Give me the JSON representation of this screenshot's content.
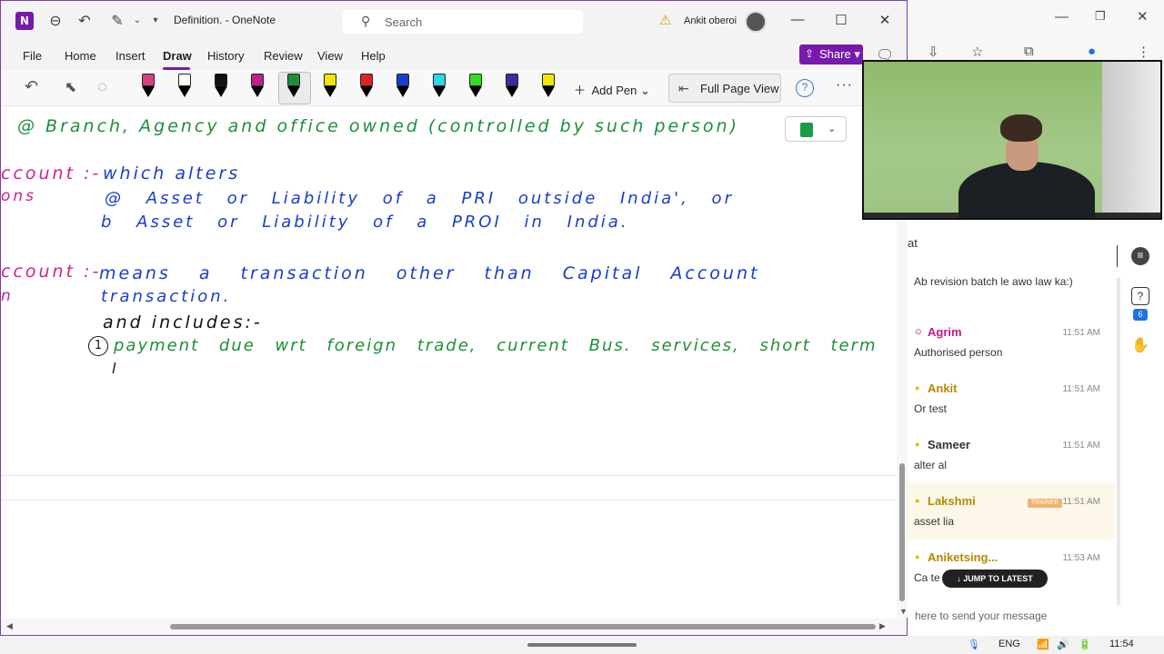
{
  "window": {
    "app_logo": "N",
    "title": "Definition.  -  OneNote",
    "search_placeholder": "Search",
    "user_name": "Ankit oberoi"
  },
  "menu": {
    "file": "File",
    "home": "Home",
    "insert": "Insert",
    "draw": "Draw",
    "history": "History",
    "review": "Review",
    "view": "View",
    "help": "Help",
    "share": "Share"
  },
  "ribbon": {
    "add_pen": "Add Pen",
    "full_page_view": "Full Page View",
    "pens": [
      {
        "color": "#d8407f",
        "name": "eraser"
      },
      {
        "color": "#ffffff",
        "name": "pen-white"
      },
      {
        "color": "#111111",
        "name": "pen-black"
      },
      {
        "color": "#c0208a",
        "name": "pen-magenta"
      },
      {
        "color": "#1d8f3a",
        "name": "pen-green-selected"
      },
      {
        "color": "#f2e500",
        "name": "highlighter-yellow"
      },
      {
        "color": "#e0202a",
        "name": "pen-red"
      },
      {
        "color": "#1a3ccc",
        "name": "pen-blue"
      },
      {
        "color": "#2ad8e8",
        "name": "highlighter-cyan"
      },
      {
        "color": "#33dd22",
        "name": "highlighter-green"
      },
      {
        "color": "#3a2f9a",
        "name": "pen-indigo"
      },
      {
        "color": "#f5e600",
        "name": "pen-yellow"
      }
    ]
  },
  "notes": {
    "line_branch": "@ Branch, Agency and office owned (controlled by such person)",
    "cap_account_1": "ccount :-",
    "cap_account_2": "ons",
    "which_alters": "which alters",
    "item_a": "@ Asset or Liability of a PRI outside India', or",
    "item_b": "b Asset or Liability of a PROI in India.",
    "cur_account_1": "ccount :-",
    "cur_account_2": "n",
    "means": "means a transaction other than Capital Account",
    "transaction": "transaction.",
    "and_includes": "and includes:-",
    "item_1_num": "1",
    "item_1": "payment due wrt foreign trade, current Bus. services, short term",
    "cursor_line": "l"
  },
  "chat": {
    "title": "at",
    "messages": [
      {
        "name": "",
        "time": "",
        "text": "Ab revision batch le awo law ka:)",
        "color": "#333333"
      },
      {
        "name": "Agrim",
        "time": "11:51 AM",
        "text": "Authorised person",
        "color": "#c2188a"
      },
      {
        "name": "Ankit",
        "time": "11:51 AM",
        "text": "Or test",
        "color": "#b58a00"
      },
      {
        "name": "Sameer",
        "time": "11:51 AM",
        "text": "alter al",
        "color": "#333333"
      },
      {
        "name": "Lakshmi",
        "time": "11:51 AM",
        "text": "asset lia",
        "color": "#b58a00"
      },
      {
        "name": "Aniketsing...",
        "time": "11:53 AM",
        "text": "Ca te",
        "color": "#b58a00"
      }
    ],
    "trainer_badge": "TRAINEE",
    "qa_count": "6",
    "jump_to_latest": "↓ JUMP TO LATEST",
    "input_placeholder": "here to send your message"
  },
  "taskbar": {
    "language": "ENG",
    "time": "11:54"
  }
}
